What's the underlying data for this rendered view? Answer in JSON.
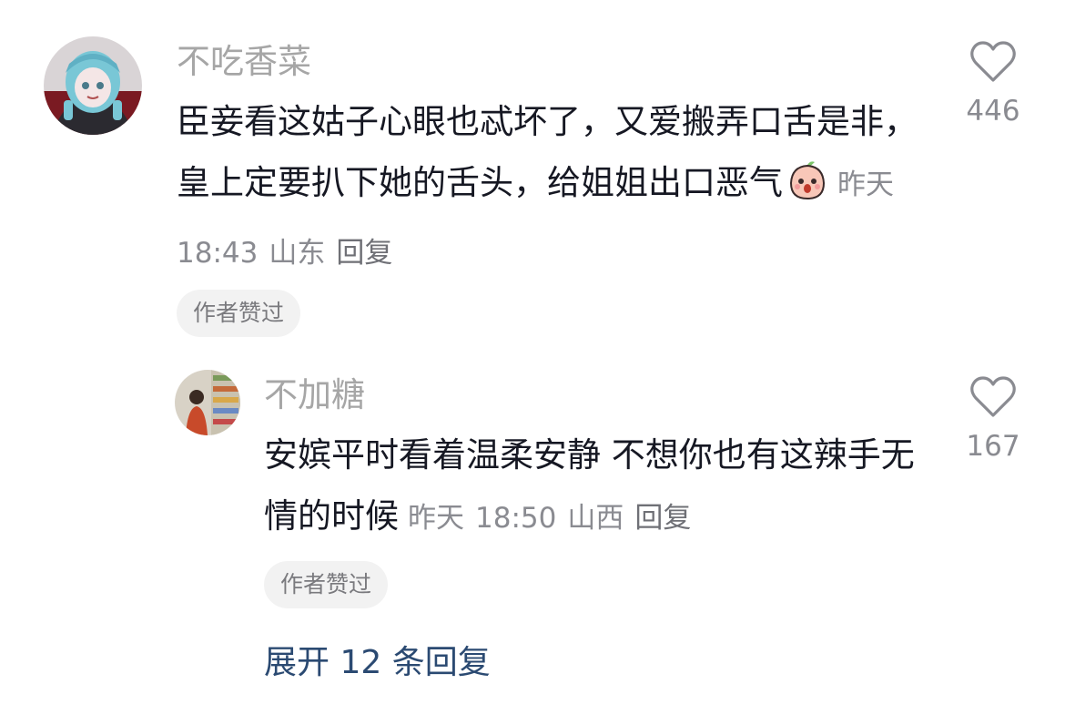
{
  "comments": [
    {
      "username": "不吃香菜",
      "text": "臣妾看这姑子心眼也忒坏了，又爱搬弄口舌是非，皇上定要扒下她的舌头，给姐姐出口恶气",
      "date": "昨天",
      "time": "18:43",
      "location": "山东",
      "reply_label": "回复",
      "like_count": "446",
      "author_liked": "作者赞过"
    },
    {
      "username": "不加糖",
      "text": "安嫔平时看着温柔安静 不想你也有这辣手无情的时候",
      "date": "昨天",
      "time": "18:50",
      "location": "山西",
      "reply_label": "回复",
      "like_count": "167",
      "author_liked": "作者赞过"
    }
  ],
  "expand_replies": "展开 12 条回复",
  "icons": {
    "like": "heart-outline-icon",
    "emoji": "peach-face-emoji-icon"
  },
  "colors": {
    "text": "#161823",
    "username": "#a6a6a6",
    "meta": "#8a8b91",
    "link": "#2b4a72",
    "chip_bg": "#f2f2f2"
  }
}
